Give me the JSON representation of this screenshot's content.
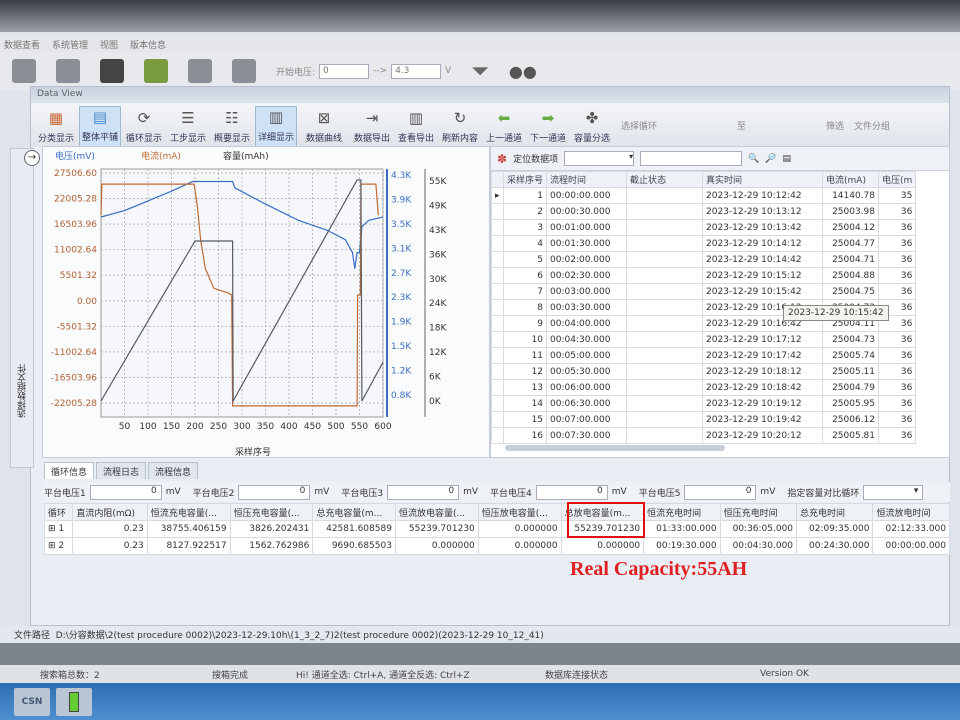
{
  "menu": [
    "数据查看",
    "系统管理",
    "视图",
    "版本信息"
  ],
  "main_toolbar": {
    "start_voltage_label": "开始电压:",
    "start_voltage_value": "0",
    "arrow": "-->",
    "end_voltage_value": "4.3",
    "unit": "V"
  },
  "window": {
    "title": "Data View"
  },
  "toolbar": {
    "items": [
      "分类显示",
      "整体平铺",
      "循环显示",
      "工步显示",
      "概要显示",
      "详细显示",
      "数据曲线",
      "数据导出",
      "查看导出",
      "刷新内容",
      "上一通道",
      "下一通道",
      "容量分选"
    ],
    "select_cycle_label": "选择循环",
    "to_label": "至",
    "filter_label": "筛选",
    "file_group_label": "文件分组"
  },
  "side_tab": "选择数据文件",
  "chart_data": {
    "type": "line",
    "title": "",
    "xlabel": "采样序号",
    "legend": [
      "电压(mV)",
      "电流(mA)",
      "容量(mAh)"
    ],
    "x_ticks": [
      50,
      100,
      150,
      200,
      250,
      300,
      350,
      400,
      450,
      500,
      550,
      600
    ],
    "xlim": [
      0,
      600
    ],
    "left_axis": {
      "ticks": [
        "27506.60",
        "22005.28",
        "16503.96",
        "11002.64",
        "5501.32",
        "0.00",
        "-5501.32",
        "-11002.64",
        "-16503.96",
        "-22005.28"
      ],
      "range": [
        -27506.6,
        27506.6
      ]
    },
    "right_axis1": {
      "ticks": [
        "4.3K",
        "3.9K",
        "3.5K",
        "3.1K",
        "2.7K",
        "2.3K",
        "1.9K",
        "1.5K",
        "1.2K",
        "0.8K"
      ],
      "range": [
        800,
        4300
      ]
    },
    "right_axis2": {
      "ticks": [
        "55K",
        "49K",
        "43K",
        "36K",
        "30K",
        "24K",
        "18K",
        "12K",
        "6K",
        "0K"
      ],
      "range": [
        0,
        55000
      ]
    },
    "series": [
      {
        "name": "电压(mV)",
        "axis": "right1",
        "color": "#3a6fc4",
        "points": [
          [
            0,
            3650
          ],
          [
            50,
            3750
          ],
          [
            100,
            3900
          ],
          [
            150,
            4050
          ],
          [
            195,
            4200
          ],
          [
            280,
            4200
          ],
          [
            285,
            4100
          ],
          [
            350,
            3850
          ],
          [
            420,
            3600
          ],
          [
            480,
            3450
          ],
          [
            520,
            3300
          ],
          [
            535,
            3100
          ],
          [
            540,
            2850
          ],
          [
            545,
            3100
          ],
          [
            550,
            3100
          ],
          [
            555,
            3500
          ],
          [
            570,
            3600
          ],
          [
            600,
            3650
          ]
        ]
      },
      {
        "name": "电流(mA)",
        "axis": "left",
        "color": "#c06a30",
        "points": [
          [
            0,
            18000
          ],
          [
            2,
            25004
          ],
          [
            198,
            25004
          ],
          [
            205,
            20000
          ],
          [
            212,
            12500
          ],
          [
            222,
            6000
          ],
          [
            240,
            1500
          ],
          [
            270,
            500
          ],
          [
            278,
            0
          ],
          [
            280,
            -25004
          ],
          [
            545,
            -25004
          ],
          [
            546,
            0
          ],
          [
            552,
            0
          ],
          [
            553,
            25004
          ],
          [
            585,
            25004
          ],
          [
            590,
            18000
          ]
        ]
      },
      {
        "name": "容量(mAh)",
        "axis": "right2",
        "color": "#555b66",
        "points": [
          [
            0,
            0
          ],
          [
            200,
            40000
          ],
          [
            280,
            40000
          ],
          [
            281,
            0
          ],
          [
            545,
            55240
          ],
          [
            553,
            55240
          ],
          [
            555,
            0
          ],
          [
            600,
            9690
          ]
        ]
      }
    ]
  },
  "grid": {
    "locate_label": "定位数据项",
    "columns": [
      "采样序号",
      "流程时间",
      "截止状态",
      "真实时间",
      "电流(mA)",
      "电压(m"
    ],
    "rows": [
      [
        "1",
        "00:00:00.000",
        "",
        "2023-12-29 10:12:42",
        "14140.78",
        "35"
      ],
      [
        "2",
        "00:00:30.000",
        "",
        "2023-12-29 10:13:12",
        "25003.98",
        "36"
      ],
      [
        "3",
        "00:01:00.000",
        "",
        "2023-12-29 10:13:42",
        "25004.12",
        "36"
      ],
      [
        "4",
        "00:01:30.000",
        "",
        "2023-12-29 10:14:12",
        "25004.77",
        "36"
      ],
      [
        "5",
        "00:02:00.000",
        "",
        "2023-12-29 10:14:42",
        "25004.71",
        "36"
      ],
      [
        "6",
        "00:02:30.000",
        "",
        "2023-12-29 10:15:12",
        "25004.88",
        "36"
      ],
      [
        "7",
        "00:03:00.000",
        "",
        "2023-12-29 10:15:42",
        "25004.75",
        "36"
      ],
      [
        "8",
        "00:03:30.000",
        "",
        "2023-12-29 10:16:12",
        "25004.73",
        "36"
      ],
      [
        "9",
        "00:04:00.000",
        "",
        "2023-12-29 10:16:42",
        "25004.11",
        "36"
      ],
      [
        "10",
        "00:04:30.000",
        "",
        "2023-12-29 10:17:12",
        "25004.73",
        "36"
      ],
      [
        "11",
        "00:05:00.000",
        "",
        "2023-12-29 10:17:42",
        "25005.74",
        "36"
      ],
      [
        "12",
        "00:05:30.000",
        "",
        "2023-12-29 10:18:12",
        "25005.11",
        "36"
      ],
      [
        "13",
        "00:06:00.000",
        "",
        "2023-12-29 10:18:42",
        "25004.79",
        "36"
      ],
      [
        "14",
        "00:06:30.000",
        "",
        "2023-12-29 10:19:12",
        "25005.95",
        "36"
      ],
      [
        "15",
        "00:07:00.000",
        "",
        "2023-12-29 10:19:42",
        "25006.12",
        "36"
      ],
      [
        "16",
        "00:07:30.000",
        "",
        "2023-12-29 10:20:12",
        "25005.81",
        "36"
      ]
    ],
    "tooltip": "2023-12-29 10:15:42"
  },
  "tabs": [
    "循环信息",
    "流程日志",
    "流程信息"
  ],
  "platform": {
    "items": [
      {
        "label": "平台电压1",
        "value": "0"
      },
      {
        "label": "平台电压2",
        "value": "0"
      },
      {
        "label": "平台电压3",
        "value": "0"
      },
      {
        "label": "平台电压4",
        "value": "0"
      },
      {
        "label": "平台电压5",
        "value": "0"
      }
    ],
    "unit": "mV",
    "compare_label": "指定容量对比循环"
  },
  "cycle": {
    "columns": [
      "循环",
      "直流内阻(mΩ)",
      "恒流充电容量(...",
      "恒压充电容量(...",
      "总充电容量(m...",
      "恒流放电容量(...",
      "恒压放电容量(...",
      "总放电容量(m...",
      "恒流充电时间",
      "恒压充电时间",
      "总充电时间",
      "恒流放电时间"
    ],
    "rows": [
      [
        "1",
        "0.23",
        "38755.406159",
        "3826.202431",
        "42581.608589",
        "55239.701230",
        "0.000000",
        "55239.701230",
        "01:33:00.000",
        "00:36:05.000",
        "02:09:35.000",
        "02:12:33.000"
      ],
      [
        "2",
        "0.23",
        "8127.922517",
        "1562.762986",
        "9690.685503",
        "0.000000",
        "0.000000",
        "0.000000",
        "00:19:30.000",
        "00:04:30.000",
        "00:24:30.000",
        "00:00:00.000"
      ]
    ]
  },
  "annotation": "Real Capacity:55AH",
  "file_path": {
    "label": "文件路径",
    "value": "D:\\分容数据\\2(test procedure 0002)\\2023-12-29.10h\\(1_3_2_7)2(test procedure 0002)(2023-12-29 10_12_41)"
  },
  "status": {
    "total": "搜索箱总数：2",
    "done": "搜箱完成",
    "hint": "Hi!   通道全选: Ctrl+A, 通道全反选: Ctrl+Z",
    "db": "数据库连接状态",
    "version": "Version OK"
  },
  "taskbar": {
    "app": "CSN"
  }
}
